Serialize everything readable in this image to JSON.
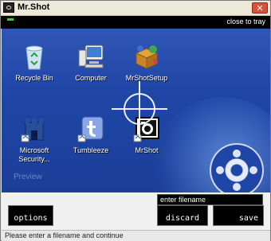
{
  "window": {
    "title": "Mr.Shot",
    "close_glyph": "✕"
  },
  "topbar": {
    "close_to_tray": "close to tray"
  },
  "desktop": {
    "icons": [
      {
        "label": "Recycle Bin",
        "icon": "recycle-bin-icon"
      },
      {
        "label": "Computer",
        "icon": "computer-icon"
      },
      {
        "label": "MrShotSetup",
        "icon": "installer-icon"
      },
      {
        "label": "Microsoft Security...",
        "icon": "security-icon"
      },
      {
        "label": "Tumbleeze",
        "icon": "tumbleeze-icon"
      },
      {
        "label": "MrShot",
        "icon": "camera-icon"
      }
    ],
    "preview_label": "Preview"
  },
  "controls": {
    "filename_placeholder": "enter filename",
    "options_label": "options",
    "discard_label": "discard",
    "save_label": "save"
  },
  "status_text": "Please enter a filename and continue",
  "colors": {
    "desktop_blue": "#1f46a6",
    "led_green": "#39d239",
    "close_red": "#d8523a"
  }
}
